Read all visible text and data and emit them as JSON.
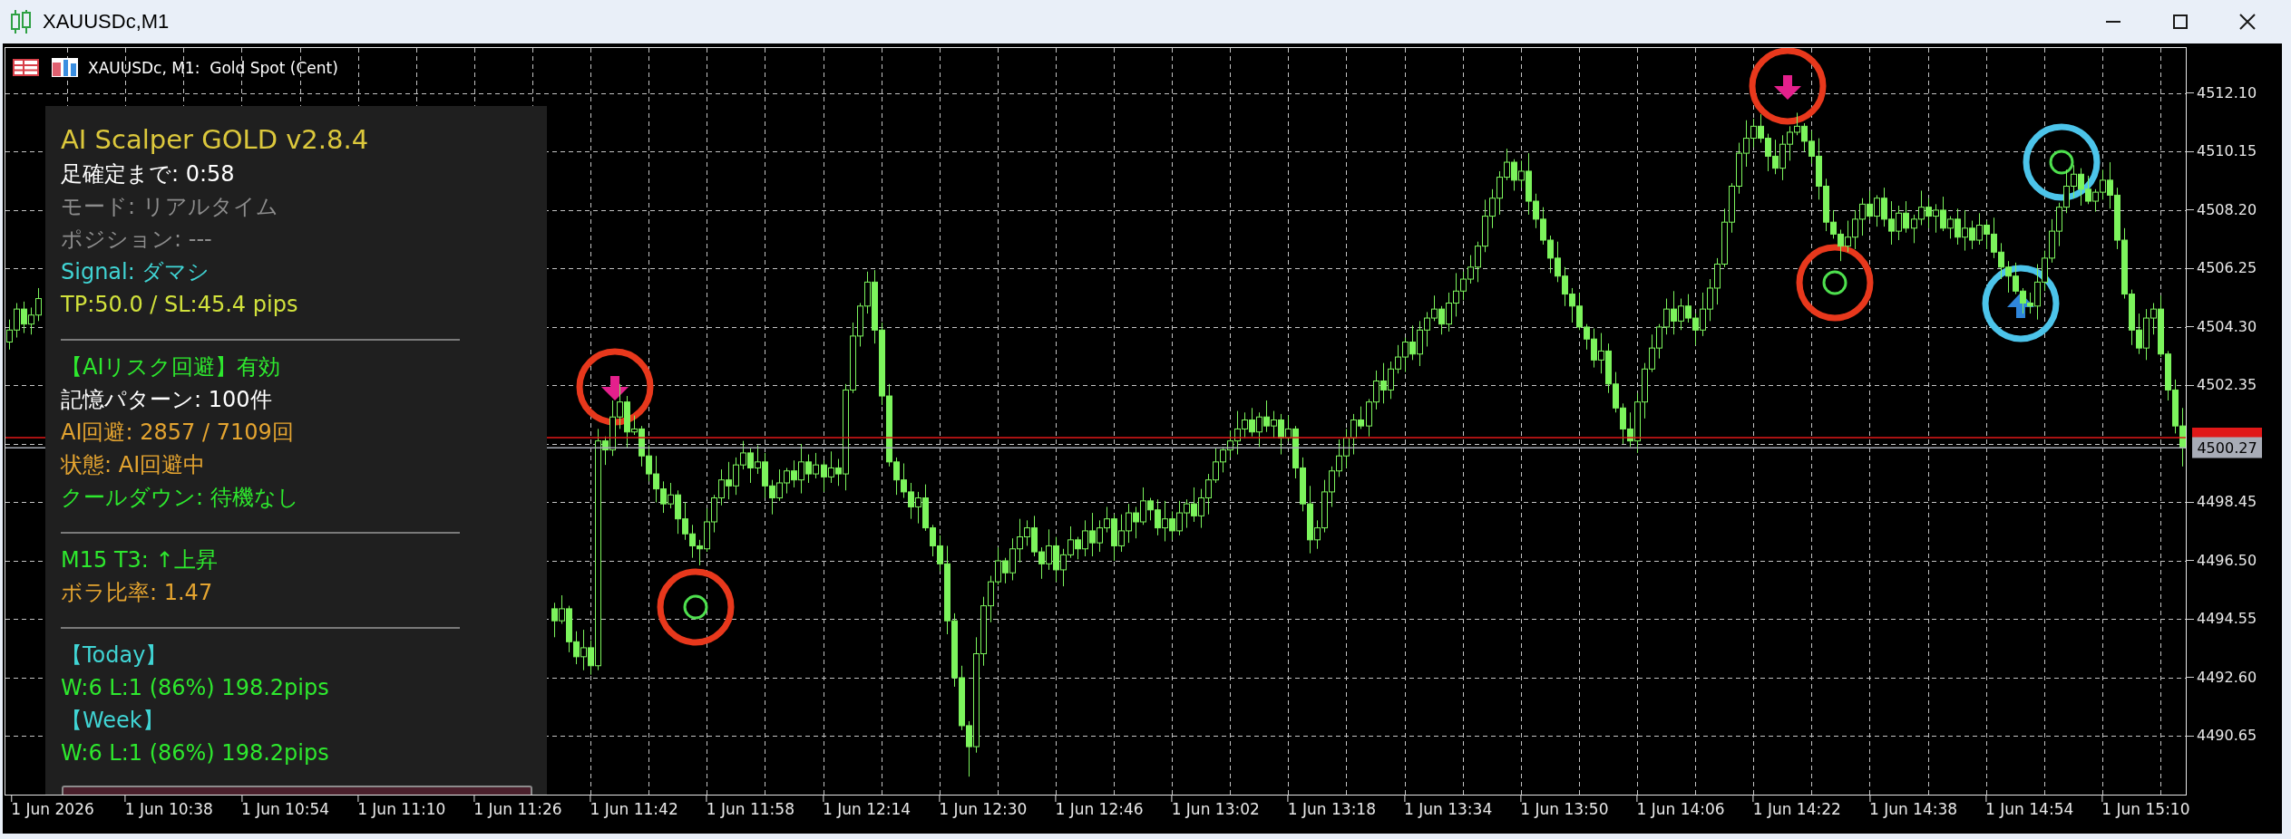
{
  "window": {
    "title": "XAUUSDc,M1"
  },
  "chart": {
    "header": "XAUUSDc, M1:  Gold Spot (Cent)",
    "chart_data": {
      "type": "candlestick",
      "grid": true,
      "categories": [
        null,
        null,
        null,
        null,
        null,
        null,
        "1 Jun 2026",
        null,
        null,
        null,
        null,
        null,
        null,
        null,
        null,
        null,
        null,
        null,
        null,
        null,
        null,
        null,
        "1 Jun 10:38",
        null,
        null,
        null,
        null,
        null,
        null,
        null,
        null,
        null,
        null,
        null,
        null,
        null,
        null,
        null,
        "1 Jun 10:54",
        null,
        null,
        null,
        null,
        null,
        null,
        null,
        null,
        null,
        null,
        null,
        null,
        null,
        null,
        null,
        "1 Jun 11:10",
        null,
        null,
        null,
        null,
        null,
        null,
        null,
        null,
        null,
        null,
        null,
        null,
        null,
        null,
        null,
        "1 Jun 11:26",
        null,
        null,
        null,
        null,
        null,
        null,
        null,
        null,
        null,
        null,
        null,
        null,
        null,
        null,
        null,
        "1 Jun 11:42",
        null,
        null,
        null,
        null,
        null,
        null,
        null,
        null,
        null,
        null,
        null,
        null,
        null,
        null,
        null,
        "1 Jun 11:58",
        null,
        null,
        null,
        null,
        null,
        null,
        null,
        null,
        null,
        null,
        null,
        null,
        null,
        null,
        null,
        "1 Jun 12:14",
        null,
        null,
        null,
        null,
        null,
        null,
        null,
        null,
        null,
        null,
        null,
        null,
        null,
        null,
        null,
        "1 Jun 12:30",
        null,
        null,
        null,
        null,
        null,
        null,
        null,
        null,
        null,
        null,
        null,
        null,
        null,
        null,
        null,
        "1 Jun 12:46",
        null,
        null,
        null,
        null,
        null,
        null,
        null,
        null,
        null,
        null,
        null,
        null,
        null,
        null,
        null,
        "1 Jun 13:02",
        null,
        null,
        null,
        null,
        null,
        null,
        null,
        null,
        null,
        null,
        null,
        null,
        null,
        null,
        null,
        "1 Jun 13:18",
        null,
        null,
        null,
        null,
        null,
        null,
        null,
        null,
        null,
        null,
        null,
        null,
        null,
        null,
        null,
        "1 Jun 13:34",
        null,
        null,
        null,
        null,
        null,
        null,
        null,
        null,
        null,
        null,
        null,
        null,
        null,
        null,
        null,
        "1 Jun 13:50",
        null,
        null,
        null,
        null,
        null,
        null,
        null,
        null,
        null,
        null,
        null,
        null,
        null,
        null,
        null,
        "1 Jun 14:06",
        null,
        null,
        null,
        null,
        null,
        null,
        null,
        null,
        null,
        null,
        null,
        null,
        null,
        null,
        null,
        "1 Jun 14:22",
        null,
        null,
        null,
        null,
        null,
        null,
        null,
        null,
        null,
        null,
        null,
        null,
        null,
        null,
        null,
        "1 Jun 14:38",
        null,
        null,
        null,
        null,
        null,
        null,
        null,
        null,
        null,
        null,
        null,
        null,
        null,
        null,
        null,
        "1 Jun 14:54",
        null,
        null,
        null,
        null,
        null,
        null,
        null,
        null,
        null,
        null,
        null,
        null,
        null,
        null,
        null,
        "1 Jun 15:10",
        null,
        null,
        null,
        null,
        null
      ],
      "ohlc": [
        [
          4503.8,
          4504.55,
          4503.55,
          4504.2
        ],
        [
          4504.2,
          4505.1,
          4503.95,
          4504.9
        ],
        [
          4504.9,
          4505.15,
          4504.1,
          4504.4
        ],
        [
          4504.4,
          4504.95,
          4504.05,
          4504.7
        ],
        [
          4504.7,
          4505.6,
          4504.5,
          4505.25
        ],
        null,
        null,
        null,
        null,
        null,
        null,
        null,
        null,
        null,
        null,
        null,
        null,
        null,
        null,
        null,
        null,
        null,
        null,
        null,
        null,
        null,
        null,
        null,
        null,
        null,
        null,
        null,
        null,
        null,
        null,
        null,
        null,
        null,
        null,
        null,
        null,
        null,
        null,
        null,
        null,
        null,
        null,
        null,
        null,
        null,
        null,
        null,
        null,
        null,
        null,
        null,
        null,
        null,
        null,
        null,
        null,
        null,
        null,
        null,
        null,
        null,
        null,
        null,
        null,
        null,
        null,
        null,
        null,
        null,
        null,
        [
          4494.9,
          4495.1,
          4493.95,
          4494.5
        ],
        [
          4494.5,
          4495.35,
          4494.4,
          4494.9
        ],
        [
          4494.9,
          4495.0,
          4493.45,
          4493.8
        ],
        [
          4493.8,
          4494.15,
          4493.05,
          4493.3
        ],
        [
          4493.3,
          4494.2,
          4492.85,
          4493.6
        ],
        [
          4493.6,
          4493.85,
          4492.7,
          4493.0
        ],
        [
          4493.0,
          4500.9,
          4492.85,
          4500.5
        ],
        [
          4500.5,
          4500.65,
          4499.7,
          4500.2
        ],
        [
          4500.2,
          4501.85,
          4500.0,
          4501.3
        ],
        [
          4501.3,
          4502.4,
          4500.9,
          4501.8
        ],
        [
          4501.8,
          4502.0,
          4500.25,
          4500.8
        ],
        [
          4500.8,
          4501.35,
          4500.7,
          4500.9
        ],
        [
          4500.9,
          4501.0,
          4499.65,
          4500.0
        ],
        [
          4500.0,
          4500.35,
          4499.15,
          4499.4
        ],
        [
          4499.4,
          4500.0,
          4498.45,
          4498.9
        ],
        [
          4498.9,
          4499.15,
          4498.1,
          4498.4
        ],
        [
          4498.4,
          4499.1,
          4498.25,
          4498.7
        ],
        [
          4498.7,
          4498.85,
          4497.4,
          4497.9
        ],
        [
          4497.9,
          4498.45,
          4497.2,
          4497.4
        ],
        [
          4497.4,
          4497.7,
          4496.6,
          4497.0
        ],
        [
          4497.0,
          4497.2,
          4496.35,
          4496.9
        ],
        [
          4496.9,
          4498.25,
          4496.8,
          4497.8
        ],
        [
          4497.8,
          4498.7,
          4497.45,
          4498.6
        ],
        [
          4498.6,
          4499.55,
          4498.35,
          4499.2
        ],
        [
          4499.2,
          4499.8,
          4498.55,
          4499.0
        ],
        [
          4499.0,
          4499.95,
          4498.7,
          4499.7
        ],
        [
          4499.7,
          4500.5,
          4499.55,
          4500.1
        ],
        [
          4500.1,
          4500.25,
          4499.1,
          4499.6
        ],
        [
          4499.6,
          4500.35,
          4499.4,
          4499.8
        ],
        [
          4499.8,
          4500.1,
          4498.6,
          4499.0
        ],
        [
          4499.0,
          4499.2,
          4498.05,
          4498.6
        ],
        [
          4498.6,
          4499.55,
          4498.5,
          4499.1
        ],
        [
          4499.1,
          4499.6,
          4498.75,
          4499.5
        ],
        [
          4499.5,
          4499.85,
          4498.95,
          4499.2
        ],
        [
          4499.2,
          4500.4,
          4498.75,
          4499.8
        ],
        [
          4499.8,
          4500.05,
          4499.1,
          4499.4
        ],
        [
          4499.4,
          4500.1,
          4499.25,
          4499.7
        ],
        [
          4499.7,
          4499.85,
          4498.8,
          4499.3
        ],
        [
          4499.3,
          4500.15,
          4499.1,
          4499.6
        ],
        [
          4499.6,
          4499.9,
          4499.0,
          4499.4
        ],
        [
          4499.4,
          4502.4,
          4498.85,
          4502.2
        ],
        [
          4502.2,
          4504.45,
          4502.1,
          4504.0
        ],
        [
          4504.0,
          4505.1,
          4503.65,
          4505.0
        ],
        [
          4505.0,
          4506.15,
          4504.75,
          4505.8
        ],
        [
          4505.8,
          4506.2,
          4503.75,
          4504.2
        ],
        [
          4504.2,
          4504.45,
          4501.7,
          4502.0
        ],
        [
          4502.0,
          4502.4,
          4499.65,
          4499.8
        ],
        [
          4499.8,
          4499.95,
          4498.7,
          4499.2
        ],
        [
          4499.2,
          4499.75,
          4498.6,
          4498.8
        ],
        [
          4498.8,
          4499.1,
          4497.9,
          4498.3
        ],
        [
          4498.3,
          4498.8,
          4497.75,
          4498.6
        ],
        [
          4498.6,
          4499.05,
          4497.5,
          4497.6
        ],
        [
          4497.6,
          4497.7,
          4496.65,
          4497.0
        ],
        [
          4497.0,
          4497.35,
          4496.15,
          4496.4
        ],
        [
          4496.4,
          4497.0,
          4494.05,
          4494.5
        ],
        [
          4494.5,
          4494.75,
          4492.3,
          4492.6
        ],
        [
          4492.6,
          4493.0,
          4490.85,
          4491.0
        ],
        [
          4491.0,
          4491.15,
          4489.3,
          4490.3
        ],
        [
          4490.3,
          4493.95,
          4490.1,
          4493.4
        ],
        [
          4493.4,
          4495.3,
          4493.0,
          4495.0
        ],
        [
          4495.0,
          4496.0,
          4494.45,
          4495.8
        ],
        [
          4495.8,
          4496.95,
          4495.7,
          4496.5
        ],
        [
          4496.5,
          4496.6,
          4495.75,
          4496.1
        ],
        [
          4496.1,
          4497.25,
          4495.85,
          4496.9
        ],
        [
          4496.9,
          4497.9,
          4496.45,
          4497.3
        ],
        [
          4497.3,
          4497.85,
          4497.0,
          4497.6
        ],
        [
          4497.6,
          4498.0,
          4496.65,
          4496.8
        ],
        [
          4496.8,
          4496.95,
          4495.9,
          4496.4
        ],
        [
          4496.4,
          4497.55,
          4496.2,
          4497.0
        ],
        [
          4497.0,
          4497.3,
          4495.8,
          4496.2
        ],
        [
          4496.2,
          4496.9,
          4495.65,
          4496.7
        ],
        [
          4496.7,
          4497.65,
          4496.6,
          4497.2
        ],
        [
          4497.2,
          4497.3,
          4496.55,
          4496.9
        ],
        [
          4496.9,
          4497.85,
          4496.65,
          4497.5
        ],
        [
          4497.5,
          4498.1,
          4496.65,
          4497.1
        ],
        [
          4497.1,
          4497.85,
          4496.8,
          4497.6
        ],
        [
          4497.6,
          4498.3,
          4497.45,
          4497.9
        ],
        [
          4497.9,
          4498.05,
          4496.5,
          4497.0
        ],
        [
          4497.0,
          4498.05,
          4496.8,
          4497.5
        ],
        [
          4497.5,
          4498.4,
          4497.1,
          4498.1
        ],
        [
          4498.1,
          4498.3,
          4497.25,
          4497.8
        ],
        [
          4497.8,
          4498.95,
          4497.7,
          4498.5
        ],
        [
          4498.5,
          4498.6,
          4497.85,
          4498.2
        ],
        [
          4498.2,
          4498.55,
          4497.35,
          4497.6
        ],
        [
          4497.6,
          4498.5,
          4497.15,
          4497.9
        ],
        [
          4497.9,
          4498.15,
          4497.2,
          4497.5
        ],
        [
          4497.5,
          4498.5,
          4497.35,
          4498.1
        ],
        [
          4498.1,
          4498.55,
          4497.6,
          4498.4
        ],
        [
          4498.4,
          4498.95,
          4497.8,
          4498.0
        ],
        [
          4498.0,
          4498.9,
          4497.6,
          4498.6
        ],
        [
          4498.6,
          4499.4,
          4498.05,
          4499.2
        ],
        [
          4499.2,
          4500.25,
          4499.1,
          4499.8
        ],
        [
          4499.8,
          4500.3,
          4499.45,
          4500.2
        ],
        [
          4500.2,
          4500.85,
          4499.95,
          4500.5
        ],
        [
          4500.5,
          4501.5,
          4500.05,
          4500.9
        ],
        [
          4500.9,
          4501.45,
          4500.6,
          4501.2
        ],
        [
          4501.2,
          4501.6,
          4500.65,
          4500.8
        ],
        [
          4500.8,
          4501.45,
          4500.3,
          4501.3
        ],
        [
          4501.3,
          4501.85,
          4500.8,
          4501.0
        ],
        [
          4501.0,
          4501.5,
          4500.6,
          4501.2
        ],
        [
          4501.2,
          4501.4,
          4500.05,
          4500.6
        ],
        [
          4500.6,
          4501.35,
          4500.5,
          4500.9
        ],
        [
          4500.9,
          4501.0,
          4499.25,
          4499.6
        ],
        [
          4499.6,
          4499.95,
          4498.15,
          4498.4
        ],
        [
          4498.4,
          4499.0,
          4496.75,
          4497.2
        ],
        [
          4497.2,
          4497.85,
          4496.9,
          4497.6
        ],
        [
          4497.6,
          4499.2,
          4497.45,
          4498.8
        ],
        [
          4498.8,
          4499.65,
          4498.3,
          4499.5
        ],
        [
          4499.5,
          4500.55,
          4499.3,
          4500.0
        ],
        [
          4500.0,
          4500.9,
          4499.6,
          4500.6
        ],
        [
          4500.6,
          4501.4,
          4500.05,
          4501.2
        ],
        [
          4501.2,
          4501.65,
          4500.9,
          4501.0
        ],
        [
          4501.0,
          4501.9,
          4500.65,
          4501.8
        ],
        [
          4501.8,
          4502.85,
          4501.55,
          4502.5
        ],
        [
          4502.5,
          4503.1,
          4501.75,
          4502.2
        ],
        [
          4502.2,
          4503.15,
          4501.9,
          4502.9
        ],
        [
          4502.9,
          4503.7,
          4502.75,
          4503.3
        ],
        [
          4503.3,
          4503.95,
          4502.8,
          4503.8
        ],
        [
          4503.8,
          4504.35,
          4503.2,
          4503.4
        ],
        [
          4503.4,
          4504.5,
          4503.0,
          4504.2
        ],
        [
          4504.2,
          4504.8,
          4503.65,
          4504.6
        ],
        [
          4504.6,
          4505.35,
          4504.5,
          4504.9
        ],
        [
          4504.9,
          4505.0,
          4504.05,
          4504.4
        ],
        [
          4504.4,
          4505.45,
          4504.15,
          4505.1
        ],
        [
          4505.1,
          4506.1,
          4504.65,
          4505.5
        ],
        [
          4505.5,
          4506.15,
          4505.2,
          4505.9
        ],
        [
          4505.9,
          4506.7,
          4505.75,
          4506.3
        ],
        [
          4506.3,
          4507.15,
          4505.8,
          4507.0
        ],
        [
          4507.0,
          4508.55,
          4506.8,
          4508.0
        ],
        [
          4508.0,
          4508.9,
          4507.6,
          4508.6
        ],
        [
          4508.6,
          4509.5,
          4508.05,
          4509.3
        ],
        [
          4509.3,
          4510.25,
          4509.2,
          4509.8
        ],
        [
          4509.8,
          4509.9,
          4508.85,
          4509.2
        ],
        [
          4509.2,
          4509.85,
          4508.95,
          4509.5
        ],
        [
          4509.5,
          4510.1,
          4508.05,
          4508.5
        ],
        [
          4508.5,
          4508.75,
          4507.6,
          4507.9
        ],
        [
          4507.9,
          4508.3,
          4507.05,
          4507.2
        ],
        [
          4507.2,
          4507.35,
          4506.1,
          4506.6
        ],
        [
          4506.6,
          4507.15,
          4505.8,
          4506.0
        ],
        [
          4506.0,
          4506.3,
          4505.0,
          4505.4
        ],
        [
          4505.4,
          4505.6,
          4504.45,
          4505.0
        ],
        [
          4505.0,
          4505.45,
          4504.2,
          4504.3
        ],
        [
          4504.3,
          4504.4,
          4503.55,
          4503.9
        ],
        [
          4503.9,
          4504.25,
          4502.95,
          4503.2
        ],
        [
          4503.2,
          4504.1,
          4502.75,
          4503.5
        ],
        [
          4503.5,
          4503.75,
          4502.1,
          4502.4
        ],
        [
          4502.4,
          4502.8,
          4501.45,
          4501.6
        ],
        [
          4501.6,
          4501.75,
          4500.4,
          4500.9
        ],
        [
          4500.9,
          4501.45,
          4500.3,
          4500.5
        ],
        [
          4500.5,
          4502.1,
          4500.1,
          4501.8
        ],
        [
          4501.8,
          4503.1,
          4501.25,
          4502.9
        ],
        [
          4502.9,
          4504.05,
          4502.8,
          4503.6
        ],
        [
          4503.6,
          4504.4,
          4503.25,
          4504.3
        ],
        [
          4504.3,
          4505.25,
          4504.05,
          4504.9
        ],
        [
          4504.9,
          4505.5,
          4504.05,
          4504.5
        ],
        [
          4504.5,
          4505.25,
          4504.2,
          4505.0
        ],
        [
          4505.0,
          4505.4,
          4504.45,
          4504.6
        ],
        [
          4504.6,
          4504.75,
          4503.7,
          4504.2
        ],
        [
          4504.2,
          4505.45,
          4504.0,
          4504.9
        ],
        [
          4504.9,
          4505.9,
          4504.5,
          4505.6
        ],
        [
          4505.6,
          4506.6,
          4505.05,
          4506.4
        ],
        [
          4506.4,
          4508.25,
          4506.3,
          4507.8
        ],
        [
          4507.8,
          4509.1,
          4507.45,
          4509.0
        ],
        [
          4509.0,
          4510.45,
          4508.75,
          4510.1
        ],
        [
          4510.1,
          4511.2,
          4509.65,
          4510.6
        ],
        [
          4510.6,
          4511.25,
          4510.3,
          4511.0
        ],
        [
          4511.0,
          4511.4,
          4510.45,
          4510.6
        ],
        [
          4510.6,
          4510.75,
          4509.5,
          4510.0
        ],
        [
          4510.0,
          4510.55,
          4509.4,
          4509.6
        ],
        [
          4509.6,
          4510.7,
          4509.2,
          4510.4
        ],
        [
          4510.4,
          4511.0,
          4509.85,
          4510.8
        ],
        [
          4510.8,
          4511.45,
          4510.7,
          4511.0
        ],
        [
          4511.0,
          4511.1,
          4510.15,
          4510.5
        ],
        [
          4510.5,
          4510.85,
          4509.75,
          4510.0
        ],
        [
          4510.0,
          4510.6,
          4508.55,
          4509.0
        ],
        [
          4509.0,
          4509.25,
          4507.5,
          4507.8
        ],
        [
          4507.8,
          4508.2,
          4507.25,
          4507.4
        ],
        [
          4507.4,
          4507.55,
          4506.5,
          4507.0
        ],
        [
          4507.0,
          4507.85,
          4506.8,
          4507.3
        ],
        [
          4507.3,
          4508.2,
          4506.9,
          4507.9
        ],
        [
          4507.9,
          4508.6,
          4507.35,
          4508.4
        ],
        [
          4508.4,
          4508.85,
          4507.9,
          4508.0
        ],
        [
          4508.0,
          4508.7,
          4507.65,
          4508.6
        ],
        [
          4508.6,
          4508.95,
          4507.65,
          4507.9
        ],
        [
          4507.9,
          4508.5,
          4507.05,
          4507.5
        ],
        [
          4507.5,
          4508.35,
          4507.2,
          4508.1
        ],
        [
          4508.1,
          4508.5,
          4507.45,
          4507.6
        ],
        [
          4507.6,
          4508.05,
          4507.1,
          4507.9
        ],
        [
          4507.9,
          4508.85,
          4507.7,
          4508.3
        ],
        [
          4508.3,
          4508.6,
          4507.6,
          4508.0
        ],
        [
          4508.0,
          4508.4,
          4507.45,
          4508.2
        ],
        [
          4508.2,
          4508.65,
          4507.5,
          4507.6
        ],
        [
          4507.6,
          4508.0,
          4507.25,
          4507.9
        ],
        [
          4507.9,
          4508.25,
          4507.05,
          4507.3
        ],
        [
          4507.3,
          4508.2,
          4506.85,
          4507.6
        ],
        [
          4507.6,
          4507.85,
          4506.9,
          4507.2
        ],
        [
          4507.2,
          4508.1,
          4507.05,
          4507.7
        ],
        [
          4507.7,
          4507.85,
          4506.9,
          4507.4
        ],
        [
          4507.4,
          4507.95,
          4506.6,
          4506.8
        ],
        [
          4506.8,
          4507.1,
          4505.9,
          4506.3
        ],
        [
          4506.3,
          4506.5,
          4505.45,
          4506.0
        ],
        [
          4506.0,
          4506.45,
          4505.4,
          4505.5
        ],
        [
          4505.5,
          4505.6,
          4504.75,
          4505.1
        ],
        [
          4505.1,
          4505.45,
          4504.75,
          4505.0
        ],
        [
          4505.0,
          4506.4,
          4504.55,
          4505.8
        ],
        [
          4505.8,
          4506.85,
          4505.5,
          4506.6
        ],
        [
          4506.6,
          4507.9,
          4506.45,
          4507.5
        ],
        [
          4507.5,
          4508.45,
          4507.0,
          4508.3
        ],
        [
          4508.3,
          4509.55,
          4508.1,
          4509.0
        ],
        [
          4509.0,
          4509.7,
          4508.6,
          4509.4
        ],
        [
          4509.4,
          4509.6,
          4508.35,
          4508.9
        ],
        [
          4508.9,
          4509.35,
          4508.4,
          4508.5
        ],
        [
          4508.5,
          4508.9,
          4508.15,
          4508.8
        ],
        [
          4508.8,
          4509.55,
          4508.55,
          4509.2
        ],
        [
          4509.2,
          4509.8,
          4508.25,
          4508.7
        ],
        [
          4508.7,
          4508.95,
          4506.9,
          4507.2
        ],
        [
          4507.2,
          4507.6,
          4505.25,
          4505.4
        ],
        [
          4505.4,
          4505.55,
          4503.7,
          4504.2
        ],
        [
          4504.2,
          4504.75,
          4503.4,
          4503.6
        ],
        [
          4503.6,
          4504.9,
          4503.2,
          4504.6
        ],
        [
          4504.6,
          4505.1,
          4504.05,
          4504.9
        ],
        [
          4504.9,
          4505.35,
          4503.3,
          4503.4
        ],
        [
          4503.4,
          4503.5,
          4501.85,
          4502.2
        ],
        [
          4502.2,
          4502.55,
          4500.75,
          4501.0
        ],
        [
          4501.0,
          4501.6,
          4499.65,
          4500.27
        ]
      ],
      "ylim": [
        4488.7,
        4513.61
      ],
      "yticks": [
        {
          "value": 4512.1,
          "label": "4512.10"
        },
        {
          "value": 4510.15,
          "label": "4510.15"
        },
        {
          "value": 4508.2,
          "label": "4508.20"
        },
        {
          "value": 4506.25,
          "label": "4506.25"
        },
        {
          "value": 4504.3,
          "label": "4504.30"
        },
        {
          "value": 4502.35,
          "label": "4502.35"
        },
        {
          "value": 4498.45,
          "label": "4498.45"
        },
        {
          "value": 4496.5,
          "label": "4496.50"
        },
        {
          "value": 4494.55,
          "label": "4494.55"
        },
        {
          "value": 4492.6,
          "label": "4492.60"
        },
        {
          "value": 4490.65,
          "label": "4490.65"
        }
      ],
      "ref_lines": [
        {
          "axis": "y",
          "value": 4500.61,
          "color": "#e01818"
        },
        {
          "axis": "y",
          "value": 4500.27,
          "color": "#a8acb6",
          "label": "4500.27"
        }
      ]
    },
    "markers": [
      {
        "kind": "down",
        "color": "#e8381c"
      },
      {
        "kind": "ring",
        "color": "#e8381c"
      },
      {
        "kind": "down",
        "color": "#e8381c"
      },
      {
        "kind": "ring",
        "color": "#e8381c"
      },
      {
        "kind": "up",
        "color": "#4cc4ea"
      },
      {
        "kind": "ring",
        "color": "#4cc4ea"
      }
    ]
  },
  "info_panel": {
    "title": "AI Scalper GOLD v2.8.4",
    "sections": [
      {
        "lines": [
          {
            "text": "足確定まで: 0:58",
            "color": "#ffffff"
          },
          {
            "text": "モード: リアルタイム",
            "color": "#8c8c8c"
          },
          {
            "text": "ポジション: ---",
            "color": "#8c8c8c"
          },
          {
            "text": "Signal: ダマシ",
            "color": "#40d4d4"
          },
          {
            "text": "TP:50.0 / SL:45.4 pips",
            "color": "#d2e23c"
          }
        ]
      },
      {
        "lines": [
          {
            "text": "【AIリスク回避】有効",
            "color": "#2ee82e"
          },
          {
            "text": "記憶パターン: 100件",
            "color": "#ffffff"
          },
          {
            "text": "AI回避: 2857 / 7109回",
            "color": "#e4a430"
          },
          {
            "text": "状態: AI回避中",
            "color": "#e4a430"
          },
          {
            "text": "クールダウン: 待機なし",
            "color": "#2ee82e"
          }
        ]
      },
      {
        "lines": [
          {
            "text": "M15 T3: ↑上昇",
            "color": "#2ee82e"
          },
          {
            "text": "ボラ比率: 1.47",
            "color": "#e4a430"
          }
        ]
      },
      {
        "lines": [
          {
            "text": "【Today】",
            "color": "#40d4d4"
          },
          {
            "text": "W:6 L:1 (86%) 198.2pips",
            "color": "#2ee82e"
          },
          {
            "text": "【Week】",
            "color": "#40d4d4"
          },
          {
            "text": "W:6 L:1 (86%) 198.2pips",
            "color": "#2ee82e"
          }
        ]
      }
    ]
  }
}
